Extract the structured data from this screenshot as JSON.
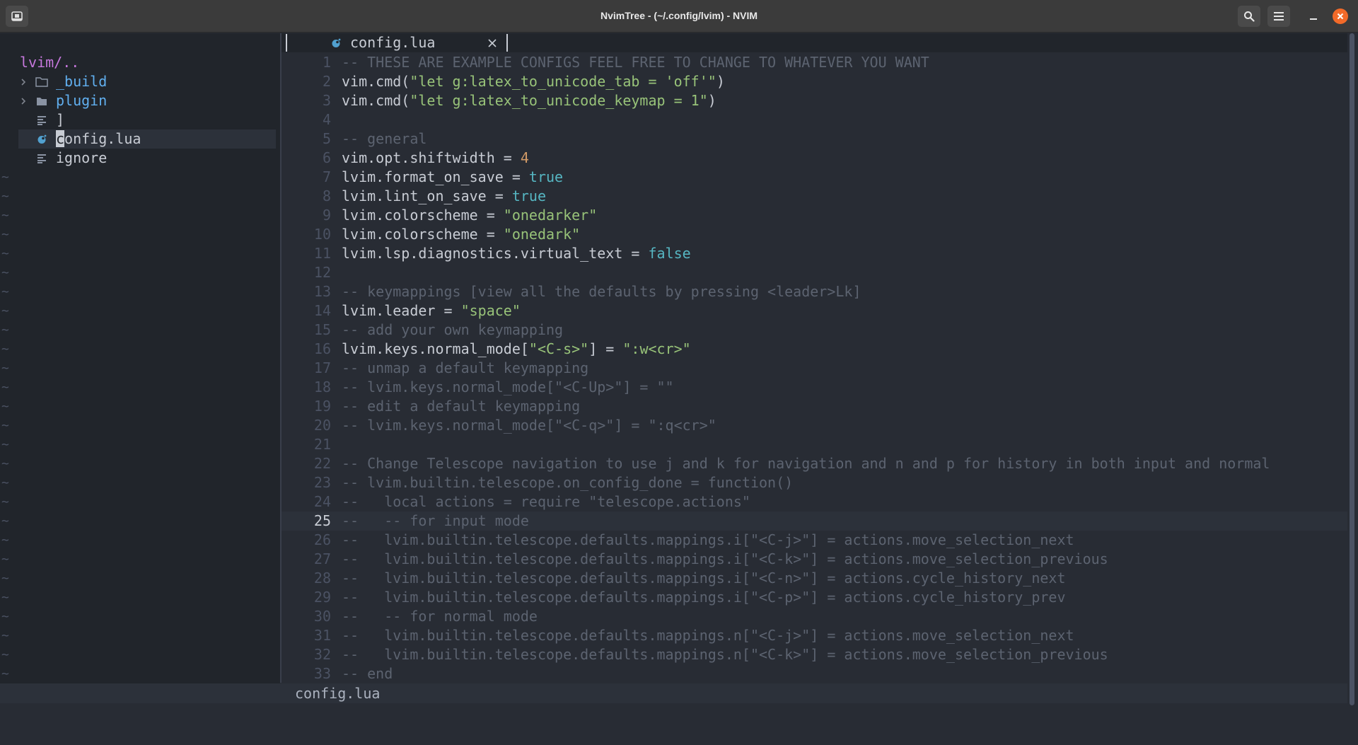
{
  "window": {
    "title": "NvimTree - (~/.config/lvim) - NVIM"
  },
  "titlebar": {
    "app_icon": "terminal-app-icon",
    "search_icon": "search-icon",
    "menu_icon": "hamburger-menu-icon",
    "minimize_icon": "minimize-icon",
    "close_icon": "close-icon"
  },
  "tree": {
    "root": "lvim/..",
    "items": [
      {
        "name": "_build",
        "kind": "dir",
        "icon": "folder-closed-icon",
        "expander": "chevron-right-icon"
      },
      {
        "name": "plugin",
        "kind": "dir",
        "icon": "folder-filled-icon",
        "expander": "chevron-right-icon"
      },
      {
        "name": "]",
        "kind": "file",
        "icon": "file-lines-icon"
      },
      {
        "name": "config.lua",
        "kind": "file",
        "icon": "lua-moon-icon",
        "selected": true
      },
      {
        "name": "ignore",
        "kind": "file",
        "icon": "file-lines-icon"
      }
    ],
    "tilde": "~"
  },
  "tab": {
    "label": "config.lua",
    "icon": "lua-moon-icon",
    "close_icon": "close-x-icon"
  },
  "editor": {
    "current_line": 25,
    "lines": [
      {
        "n": "1",
        "seg": [
          [
            "c",
            "-- THESE ARE EXAMPLE CONFIGS FEEL FREE TO CHANGE TO WHATEVER YOU WANT"
          ]
        ]
      },
      {
        "n": "2",
        "seg": [
          [
            "p",
            "vim.cmd("
          ],
          [
            "s",
            "\"let g:latex_to_unicode_tab = 'off'\""
          ],
          [
            "p",
            ")"
          ]
        ]
      },
      {
        "n": "3",
        "seg": [
          [
            "p",
            "vim.cmd("
          ],
          [
            "s",
            "\"let g:latex_to_unicode_keymap = 1\""
          ],
          [
            "p",
            ")"
          ]
        ]
      },
      {
        "n": "4",
        "seg": []
      },
      {
        "n": "5",
        "seg": [
          [
            "c",
            "-- general"
          ]
        ]
      },
      {
        "n": "6",
        "seg": [
          [
            "p",
            "vim.opt.shiftwidth = "
          ],
          [
            "n",
            "4"
          ]
        ]
      },
      {
        "n": "7",
        "seg": [
          [
            "p",
            "lvim.format_on_save = "
          ],
          [
            "b",
            "true"
          ]
        ]
      },
      {
        "n": "8",
        "seg": [
          [
            "p",
            "lvim.lint_on_save = "
          ],
          [
            "b",
            "true"
          ]
        ]
      },
      {
        "n": "9",
        "seg": [
          [
            "p",
            "lvim.colorscheme = "
          ],
          [
            "s",
            "\"onedarker\""
          ]
        ]
      },
      {
        "n": "10",
        "seg": [
          [
            "p",
            "lvim.colorscheme = "
          ],
          [
            "s",
            "\"onedark\""
          ]
        ]
      },
      {
        "n": "11",
        "seg": [
          [
            "p",
            "lvim.lsp.diagnostics.virtual_text = "
          ],
          [
            "b",
            "false"
          ]
        ]
      },
      {
        "n": "12",
        "seg": []
      },
      {
        "n": "13",
        "seg": [
          [
            "c",
            "-- keymappings [view all the defaults by pressing <leader>Lk]"
          ]
        ]
      },
      {
        "n": "14",
        "seg": [
          [
            "p",
            "lvim.leader = "
          ],
          [
            "s",
            "\"space\""
          ]
        ]
      },
      {
        "n": "15",
        "seg": [
          [
            "c",
            "-- add your own keymapping"
          ]
        ]
      },
      {
        "n": "16",
        "seg": [
          [
            "p",
            "lvim.keys.normal_mode["
          ],
          [
            "s",
            "\"<C-s>\""
          ],
          [
            "p",
            "] = "
          ],
          [
            "s",
            "\":w<cr>\""
          ]
        ]
      },
      {
        "n": "17",
        "seg": [
          [
            "c",
            "-- unmap a default keymapping"
          ]
        ]
      },
      {
        "n": "18",
        "seg": [
          [
            "c",
            "-- lvim.keys.normal_mode[\"<C-Up>\"] = \"\""
          ]
        ]
      },
      {
        "n": "19",
        "seg": [
          [
            "c",
            "-- edit a default keymapping"
          ]
        ]
      },
      {
        "n": "20",
        "seg": [
          [
            "c",
            "-- lvim.keys.normal_mode[\"<C-q>\"] = \":q<cr>\""
          ]
        ]
      },
      {
        "n": "21",
        "seg": []
      },
      {
        "n": "22",
        "seg": [
          [
            "c",
            "-- Change Telescope navigation to use j and k for navigation and n and p for history in both input and normal"
          ]
        ]
      },
      {
        "n": "23",
        "seg": [
          [
            "c",
            "-- lvim.builtin.telescope.on_config_done = function()"
          ]
        ]
      },
      {
        "n": "24",
        "seg": [
          [
            "c",
            "--   local actions = require \"telescope.actions\""
          ]
        ]
      },
      {
        "n": "25",
        "seg": [
          [
            "c",
            "--   -- for input mode"
          ]
        ]
      },
      {
        "n": "26",
        "seg": [
          [
            "c",
            "--   lvim.builtin.telescope.defaults.mappings.i[\"<C-j>\"] = actions.move_selection_next"
          ]
        ]
      },
      {
        "n": "27",
        "seg": [
          [
            "c",
            "--   lvim.builtin.telescope.defaults.mappings.i[\"<C-k>\"] = actions.move_selection_previous"
          ]
        ]
      },
      {
        "n": "28",
        "seg": [
          [
            "c",
            "--   lvim.builtin.telescope.defaults.mappings.i[\"<C-n>\"] = actions.cycle_history_next"
          ]
        ]
      },
      {
        "n": "29",
        "seg": [
          [
            "c",
            "--   lvim.builtin.telescope.defaults.mappings.i[\"<C-p>\"] = actions.cycle_history_prev"
          ]
        ]
      },
      {
        "n": "30",
        "seg": [
          [
            "c",
            "--   -- for normal mode"
          ]
        ]
      },
      {
        "n": "31",
        "seg": [
          [
            "c",
            "--   lvim.builtin.telescope.defaults.mappings.n[\"<C-j>\"] = actions.move_selection_next"
          ]
        ]
      },
      {
        "n": "32",
        "seg": [
          [
            "c",
            "--   lvim.builtin.telescope.defaults.mappings.n[\"<C-k>\"] = actions.move_selection_previous"
          ]
        ]
      },
      {
        "n": "33",
        "seg": [
          [
            "c",
            "-- end"
          ]
        ]
      }
    ]
  },
  "statusline": {
    "filename": "config.lua"
  },
  "colors": {
    "background": "#282c34",
    "tree_background": "#21252b",
    "comment": "#5c6370",
    "string": "#98c379",
    "number": "#d19a66",
    "boolean": "#56b6c2",
    "directory": "#61afef",
    "root": "#c678dd",
    "close_button": "#f26a29"
  }
}
